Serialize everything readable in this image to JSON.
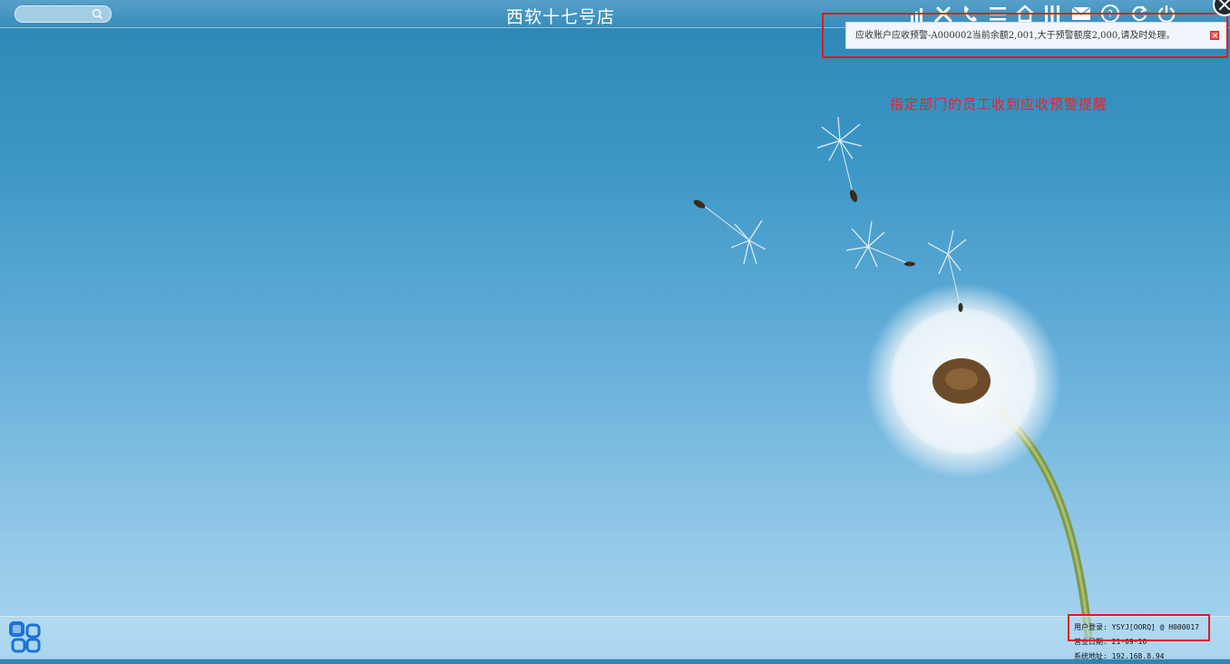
{
  "header": {
    "title": "西软十七号店",
    "search": {
      "value": "",
      "placeholder": ""
    },
    "toolbar_icons": [
      "signal-icon",
      "tools-icon",
      "phone-icon",
      "menu-icon",
      "home-icon",
      "columns-icon",
      "mail-icon",
      "help-icon",
      "refresh-icon",
      "power-icon"
    ]
  },
  "notification": {
    "message": "应收账户应收预警-A000002当前余额2,001,大于预警额度2,000,请及时处理。"
  },
  "annotation": {
    "text": "指定部门的员工收到应收预警提醒"
  },
  "status": {
    "user_label": "用户登录:",
    "user_value": "YSYJ[OORQ] @ H000017",
    "date_label": "营业日期:",
    "date_value": "21-09-16",
    "ip_label": "系统地址:",
    "ip_value": "192.168.8.94"
  },
  "colors": {
    "annotation_red": "#e3262b",
    "frame_red": "#e01a22",
    "sky_top": "#2b86b6",
    "sky_bottom": "#a9d4ee"
  }
}
